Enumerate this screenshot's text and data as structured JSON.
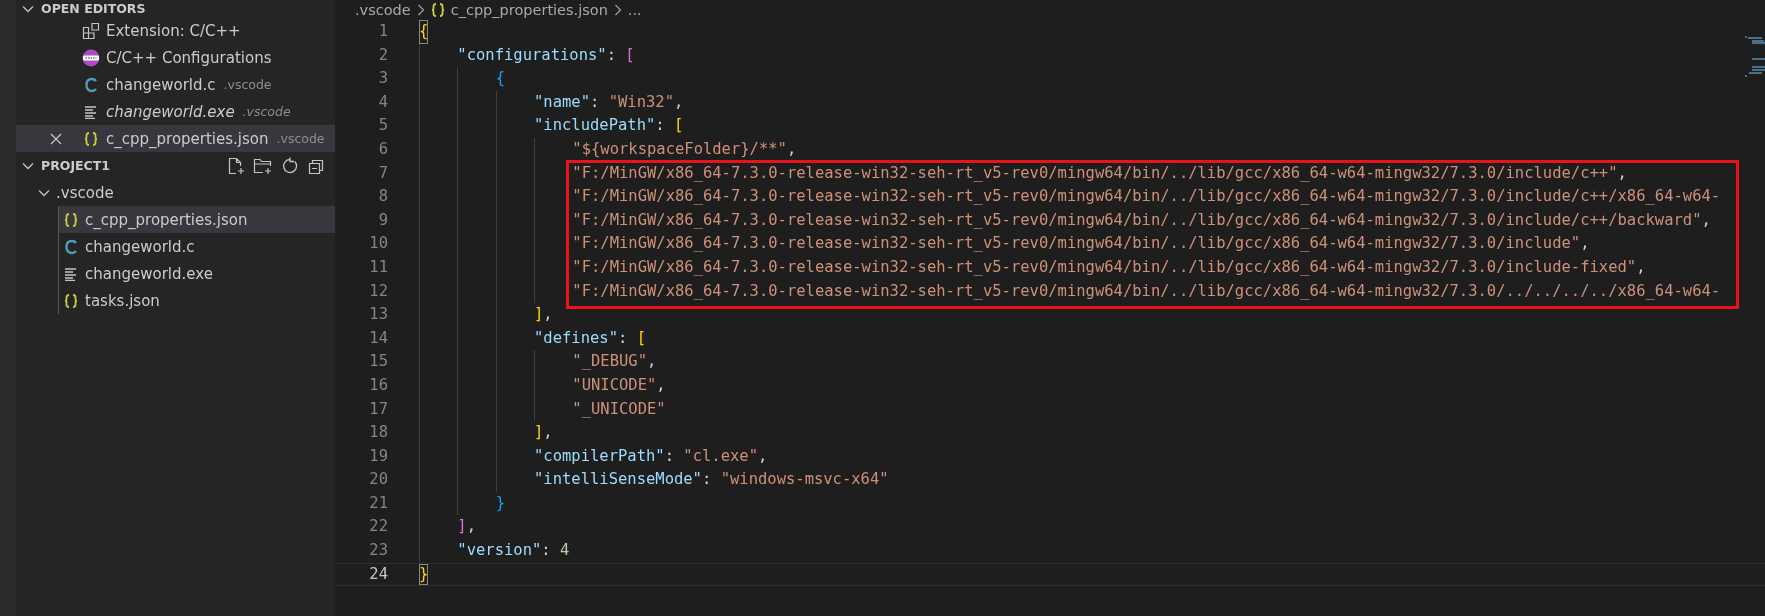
{
  "sidebar": {
    "open_editors": {
      "title": "OPEN EDITORS",
      "expanded": true,
      "items": [
        {
          "kind": "extension",
          "label": "Extension: C/C++",
          "preview": false,
          "selected": false
        },
        {
          "kind": "cpp-badge",
          "label": "C/C++ Configurations",
          "preview": false,
          "selected": false
        },
        {
          "kind": "c",
          "label": "changeworld.c",
          "detail": ".vscode",
          "preview": false,
          "selected": false
        },
        {
          "kind": "file",
          "label": "changeworld.exe",
          "detail": ".vscode",
          "preview": true,
          "selected": false
        },
        {
          "kind": "json",
          "label": "c_cpp_properties.json",
          "detail": ".vscode",
          "preview": false,
          "selected": true
        }
      ]
    },
    "project": {
      "title": "PROJECT1",
      "expanded": true,
      "actions": [
        {
          "kind": "new-file"
        },
        {
          "kind": "new-folder"
        },
        {
          "kind": "refresh"
        },
        {
          "kind": "collapse"
        }
      ],
      "tree": [
        {
          "label": ".vscode",
          "kind": "folder",
          "expanded": true,
          "selected": false,
          "children": [
            {
              "label": "c_cpp_properties.json",
              "kind": "json",
              "selected": true
            },
            {
              "label": "changeworld.c",
              "kind": "c",
              "selected": false
            },
            {
              "label": "changeworld.exe",
              "kind": "file",
              "selected": false
            },
            {
              "label": "tasks.json",
              "kind": "json",
              "selected": false
            }
          ]
        }
      ]
    }
  },
  "editor": {
    "breadcrumb": [
      {
        "kind": "folder",
        "text": ".vscode"
      },
      {
        "kind": "json",
        "text": "c_cpp_properties.json"
      },
      {
        "kind": "more",
        "text": "..."
      }
    ],
    "lines": [
      {
        "number": "1",
        "current": false,
        "highlighted": false,
        "tokens": [
          {
            "kind": "bracket",
            "t": "{",
            "color": "#ffd700",
            "matched": true
          }
        ]
      },
      {
        "number": "2",
        "current": false,
        "highlighted": false,
        "tokens": [
          {
            "kind": "key",
            "t": "    \"configurations\""
          },
          {
            "kind": "punct",
            "t": ": "
          },
          {
            "kind": "bracket",
            "t": "[",
            "color": "#da70d6",
            "matched": false
          }
        ]
      },
      {
        "number": "3",
        "current": false,
        "highlighted": false,
        "tokens": [
          {
            "kind": "bracket",
            "t": "        {",
            "color": "#179fff",
            "matched": false
          }
        ]
      },
      {
        "number": "4",
        "current": false,
        "highlighted": false,
        "tokens": [
          {
            "kind": "key",
            "t": "            \"name\""
          },
          {
            "kind": "punct",
            "t": ": "
          },
          {
            "kind": "str",
            "t": "\"Win32\""
          },
          {
            "kind": "punct",
            "t": ","
          }
        ]
      },
      {
        "number": "5",
        "current": false,
        "highlighted": false,
        "tokens": [
          {
            "kind": "key",
            "t": "            \"includePath\""
          },
          {
            "kind": "punct",
            "t": ": "
          },
          {
            "kind": "bracket",
            "t": "[",
            "color": "#ffd700",
            "matched": false
          }
        ]
      },
      {
        "number": "6",
        "current": false,
        "highlighted": false,
        "tokens": [
          {
            "kind": "str",
            "t": "                \"${workspaceFolder}/**\""
          },
          {
            "kind": "punct",
            "t": ","
          }
        ]
      },
      {
        "number": "7",
        "current": false,
        "highlighted": true,
        "tokens": [
          {
            "kind": "str",
            "t": "                \"F:/MinGW/x86_64-7.3.0-release-win32-seh-rt_v5-rev0/mingw64/bin/../lib/gcc/x86_64-w64-mingw32/7.3.0/include/c++\""
          },
          {
            "kind": "punct",
            "t": ","
          }
        ]
      },
      {
        "number": "8",
        "current": false,
        "highlighted": true,
        "tokens": [
          {
            "kind": "str",
            "t": "                \"F:/MinGW/x86_64-7.3.0-release-win32-seh-rt_v5-rev0/mingw64/bin/../lib/gcc/x86_64-w64-mingw32/7.3.0/include/c++/x86_64-w64-"
          }
        ]
      },
      {
        "number": "9",
        "current": false,
        "highlighted": true,
        "tokens": [
          {
            "kind": "str",
            "t": "                \"F:/MinGW/x86_64-7.3.0-release-win32-seh-rt_v5-rev0/mingw64/bin/../lib/gcc/x86_64-w64-mingw32/7.3.0/include/c++/backward\""
          },
          {
            "kind": "punct",
            "t": ","
          }
        ]
      },
      {
        "number": "10",
        "current": false,
        "highlighted": true,
        "tokens": [
          {
            "kind": "str",
            "t": "                \"F:/MinGW/x86_64-7.3.0-release-win32-seh-rt_v5-rev0/mingw64/bin/../lib/gcc/x86_64-w64-mingw32/7.3.0/include\""
          },
          {
            "kind": "punct",
            "t": ","
          }
        ]
      },
      {
        "number": "11",
        "current": false,
        "highlighted": true,
        "tokens": [
          {
            "kind": "str",
            "t": "                \"F:/MinGW/x86_64-7.3.0-release-win32-seh-rt_v5-rev0/mingw64/bin/../lib/gcc/x86_64-w64-mingw32/7.3.0/include-fixed\""
          },
          {
            "kind": "punct",
            "t": ","
          }
        ]
      },
      {
        "number": "12",
        "current": false,
        "highlighted": true,
        "tokens": [
          {
            "kind": "str",
            "t": "                \"F:/MinGW/x86_64-7.3.0-release-win32-seh-rt_v5-rev0/mingw64/bin/../lib/gcc/x86_64-w64-mingw32/7.3.0/../../../../x86_64-w64-"
          }
        ]
      },
      {
        "number": "13",
        "current": false,
        "highlighted": false,
        "tokens": [
          {
            "kind": "bracket",
            "t": "            ]",
            "color": "#ffd700",
            "matched": false
          },
          {
            "kind": "punct",
            "t": ","
          }
        ]
      },
      {
        "number": "14",
        "current": false,
        "highlighted": false,
        "tokens": [
          {
            "kind": "key",
            "t": "            \"defines\""
          },
          {
            "kind": "punct",
            "t": ": "
          },
          {
            "kind": "bracket",
            "t": "[",
            "color": "#ffd700",
            "matched": false
          }
        ]
      },
      {
        "number": "15",
        "current": false,
        "highlighted": false,
        "tokens": [
          {
            "kind": "str",
            "t": "                \"_DEBUG\""
          },
          {
            "kind": "punct",
            "t": ","
          }
        ]
      },
      {
        "number": "16",
        "current": false,
        "highlighted": false,
        "tokens": [
          {
            "kind": "str",
            "t": "                \"UNICODE\""
          },
          {
            "kind": "punct",
            "t": ","
          }
        ]
      },
      {
        "number": "17",
        "current": false,
        "highlighted": false,
        "tokens": [
          {
            "kind": "str",
            "t": "                \"_UNICODE\""
          }
        ]
      },
      {
        "number": "18",
        "current": false,
        "highlighted": false,
        "tokens": [
          {
            "kind": "bracket",
            "t": "            ]",
            "color": "#ffd700",
            "matched": false
          },
          {
            "kind": "punct",
            "t": ","
          }
        ]
      },
      {
        "number": "19",
        "current": false,
        "highlighted": false,
        "tokens": [
          {
            "kind": "key",
            "t": "            \"compilerPath\""
          },
          {
            "kind": "punct",
            "t": ": "
          },
          {
            "kind": "str",
            "t": "\"cl.exe\""
          },
          {
            "kind": "punct",
            "t": ","
          }
        ]
      },
      {
        "number": "20",
        "current": false,
        "highlighted": false,
        "tokens": [
          {
            "kind": "key",
            "t": "            \"intelliSenseMode\""
          },
          {
            "kind": "punct",
            "t": ": "
          },
          {
            "kind": "str",
            "t": "\"windows-msvc-x64\""
          }
        ]
      },
      {
        "number": "21",
        "current": false,
        "highlighted": false,
        "tokens": [
          {
            "kind": "bracket",
            "t": "        }",
            "color": "#179fff",
            "matched": false
          }
        ]
      },
      {
        "number": "22",
        "current": false,
        "highlighted": false,
        "tokens": [
          {
            "kind": "bracket",
            "t": "    ]",
            "color": "#da70d6",
            "matched": false
          },
          {
            "kind": "punct",
            "t": ","
          }
        ]
      },
      {
        "number": "23",
        "current": false,
        "highlighted": false,
        "tokens": [
          {
            "kind": "key",
            "t": "    \"version\""
          },
          {
            "kind": "punct",
            "t": ": "
          },
          {
            "kind": "num",
            "t": "4"
          }
        ]
      },
      {
        "number": "24",
        "current": true,
        "highlighted": false,
        "tokens": [
          {
            "kind": "bracket",
            "t": "}",
            "color": "#ffd700",
            "matched": true
          }
        ]
      }
    ]
  }
}
